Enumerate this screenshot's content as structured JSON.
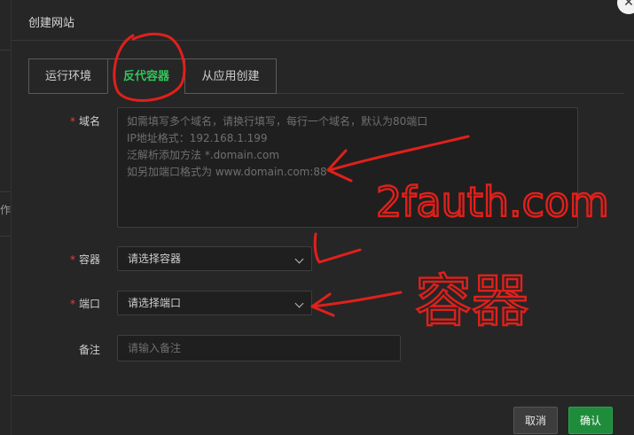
{
  "dialog": {
    "title": "创建网站",
    "close_icon": "✕"
  },
  "tabs": [
    {
      "label": "运行环境",
      "active": false
    },
    {
      "label": "反代容器",
      "active": true
    },
    {
      "label": "从应用创建",
      "active": false
    }
  ],
  "form": {
    "domain": {
      "label": "域名",
      "required": "*",
      "placeholder_lines": [
        "如需填写多个域名，请换行填写，每行一个域名，默认为80端口",
        "IP地址格式：192.168.1.199",
        "泛解析添加方法 *.domain.com",
        "如另加端口格式为 www.domain.com:88"
      ]
    },
    "container": {
      "label": "容器",
      "required": "*",
      "value": "请选择容器"
    },
    "port": {
      "label": "端口",
      "required": "*",
      "value": "请选择端口"
    },
    "remark": {
      "label": "备注",
      "placeholder": "请输入备注"
    }
  },
  "footer": {
    "cancel_label": "取消",
    "confirm_label": "确认"
  },
  "background": {
    "fragment": "作"
  },
  "annotations": {
    "domain_note": "2fauth.com",
    "container_note": "容器",
    "color": "#e0201b"
  },
  "colors": {
    "accent": "#33c45a",
    "confirm_bg": "#1f8c3b",
    "required": "#e0403c"
  }
}
